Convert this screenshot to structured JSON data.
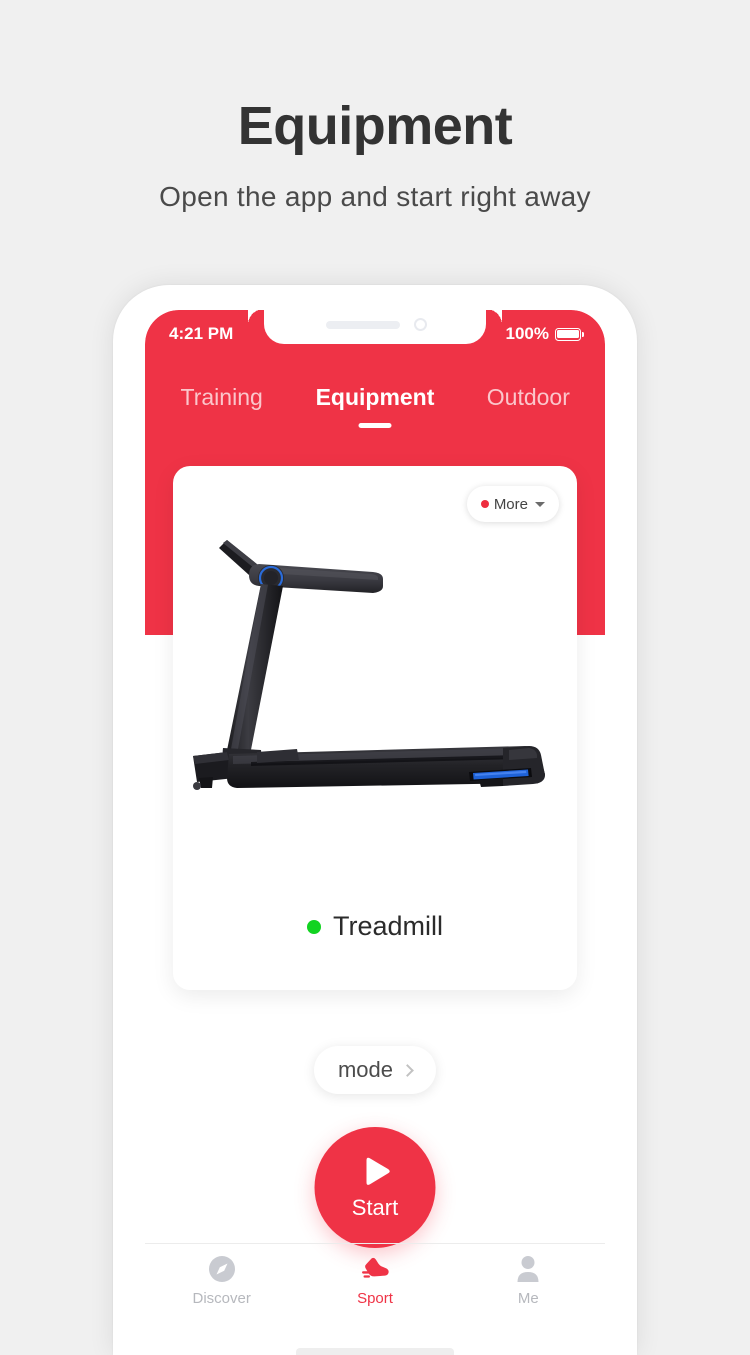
{
  "promo": {
    "title": "Equipment",
    "subtitle": "Open the app and start right away"
  },
  "colors": {
    "brand_red": "#ef3346",
    "page_background": "#f0f0f0",
    "status_green": "#12d321",
    "accent_blue": "#2a6bd8"
  },
  "phone": {
    "status_bar": {
      "time": "4:21 PM",
      "battery_percent": "100%",
      "battery_icon": "battery-full-icon",
      "speaker_icon": "notch-speaker-icon",
      "camera_icon": "notch-camera-icon"
    },
    "tabs": [
      {
        "label": "Training",
        "active": false
      },
      {
        "label": "Equipment",
        "active": true
      },
      {
        "label": "Outdoor",
        "active": false
      }
    ],
    "card": {
      "more_button": {
        "label": "More",
        "dot_color": "#ee2d3f",
        "caret_icon": "chevron-down-icon"
      },
      "product_image": "treadmill-illustration",
      "device": {
        "name": "Treadmill",
        "status_color": "#12d321"
      }
    },
    "mode_button": {
      "label": "mode",
      "chevron_icon": "chevron-right-icon"
    },
    "start_button": {
      "label": "Start",
      "play_icon": "play-triangle-icon"
    },
    "bottom_nav": [
      {
        "label": "Discover",
        "icon": "compass-icon",
        "active": false
      },
      {
        "label": "Sport",
        "icon": "running-shoe-icon",
        "active": true
      },
      {
        "label": "Me",
        "icon": "person-icon",
        "active": false
      }
    ],
    "home_indicator": "home-indicator-bar"
  }
}
